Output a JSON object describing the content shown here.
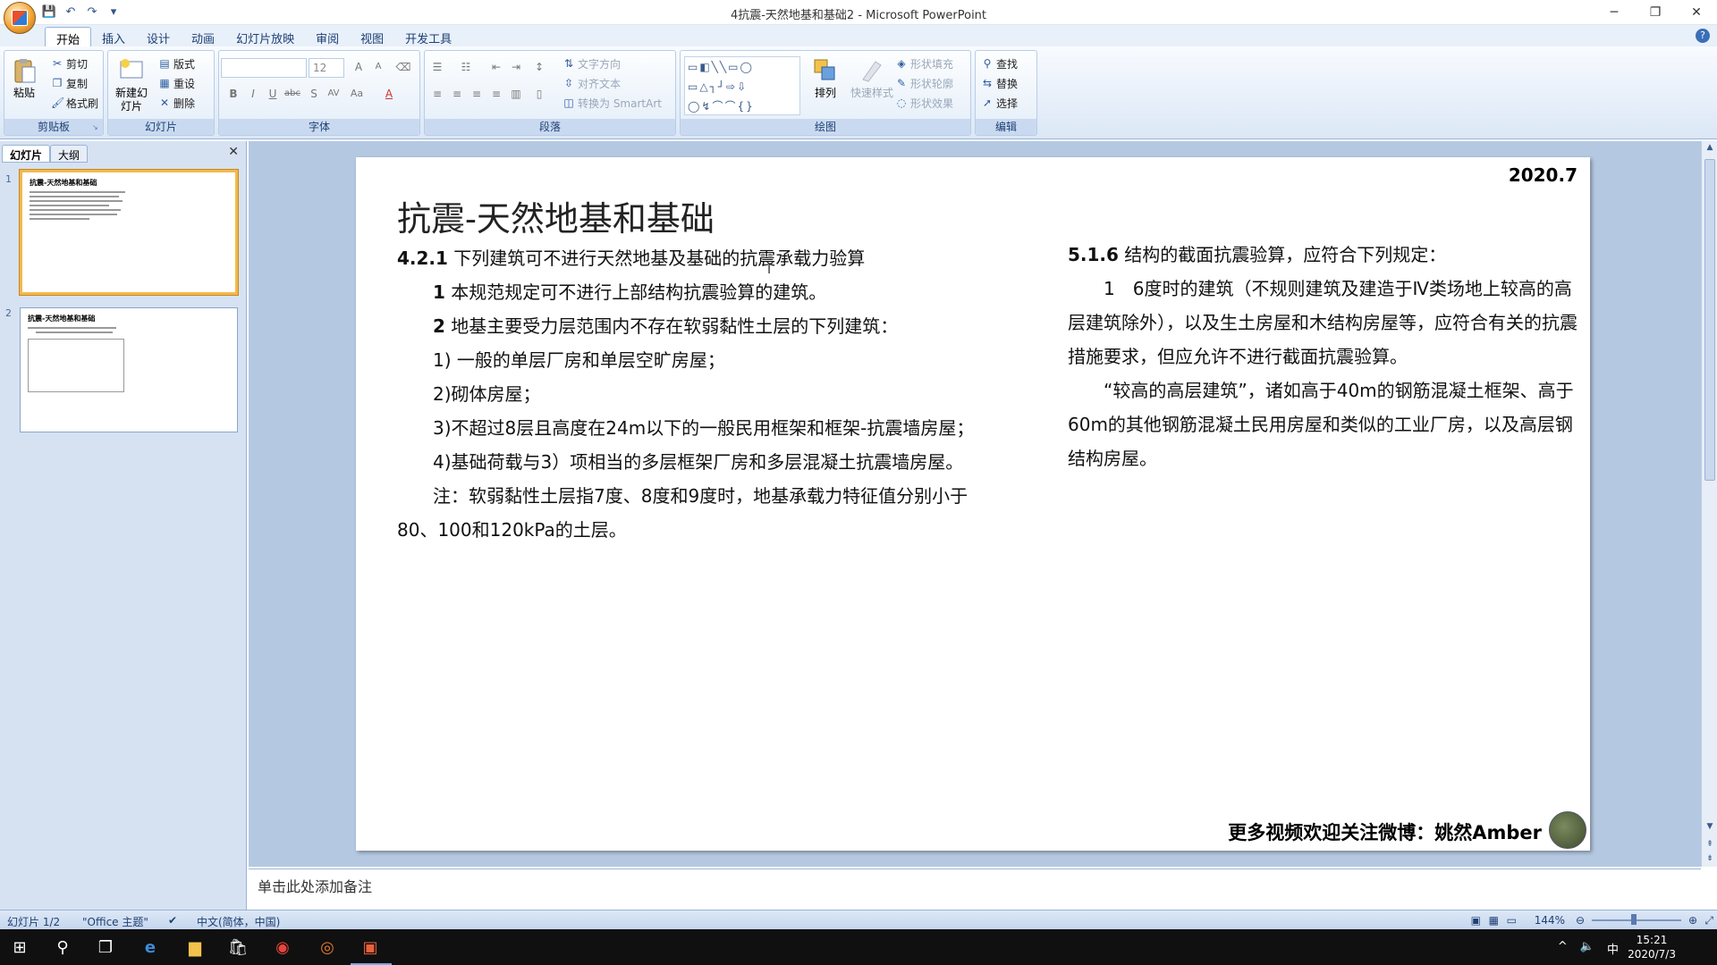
{
  "window": {
    "title": "4抗震-天然地基和基础2 - Microsoft PowerPoint"
  },
  "qat": {
    "save": "💾",
    "undo": "↶",
    "redo": "↷",
    "more": "▾"
  },
  "window_controls": {
    "min": "─",
    "max": "❐",
    "close": "✕"
  },
  "ribbon_tabs": [
    "开始",
    "插入",
    "设计",
    "动画",
    "幻灯片放映",
    "审阅",
    "视图",
    "开发工具"
  ],
  "help": "?",
  "groups": {
    "clipboard": {
      "label": "剪贴板",
      "paste": "粘贴",
      "cut": "剪切",
      "copy": "复制",
      "format_painter": "格式刷"
    },
    "slides": {
      "label": "幻灯片",
      "new_slide": "新建幻灯片",
      "layout": "版式",
      "reset": "重设",
      "delete": "删除"
    },
    "font": {
      "label": "字体",
      "font_size": "12"
    },
    "paragraph": {
      "label": "段落",
      "text_direction": "文字方向",
      "align_text": "对齐文本",
      "smartart": "转换为 SmartArt"
    },
    "drawing": {
      "label": "绘图",
      "arrange": "排列",
      "quick_styles": "快速样式",
      "shape_fill": "形状填充",
      "shape_outline": "形状轮廓",
      "shape_effects": "形状效果"
    },
    "editing": {
      "label": "编辑",
      "find": "查找",
      "replace": "替换",
      "select": "选择"
    }
  },
  "panel": {
    "tab_slides": "幻灯片",
    "tab_outline": "大纲",
    "close": "✕"
  },
  "thumbs": [
    {
      "num": "1",
      "title": "抗震-天然地基和基础"
    },
    {
      "num": "2",
      "title": "抗震-天然地基和基础"
    }
  ],
  "slide": {
    "date": "2020.7",
    "title": "抗震-天然地基和基础",
    "left": {
      "h_num": "4.2.1",
      "h_text": " 下列建筑可不进行天然地基及基础的抗震承载力验算",
      "p1_num": "1",
      "p1_text": " 本规范规定可不进行上部结构抗震验算的建筑。",
      "p2_num": "2",
      "p2_text": " 地基主要受力层范围内不存在软弱黏性土层的下列建筑：",
      "i1": "1) 一般的单层厂房和单层空旷房屋；",
      "i2": "2)砌体房屋；",
      "i3": "3)不超过8层且高度在24m以下的一般民用框架和框架-抗震墙房屋；",
      "i4": "4)基础荷载与3）项相当的多层框架厂房和多层混凝土抗震墙房屋。",
      "note": "注：软弱黏性土层指7度、8度和9度时，地基承载力特征值分别小于80、100和120kPa的土层。"
    },
    "right": {
      "h_num": "5.1.6",
      "h_text": " 结构的截面抗震验算，应符合下列规定：",
      "p1": "1　6度时的建筑（不规则建筑及建造于Ⅳ类场地上较高的高层建筑除外），以及生土房屋和木结构房屋等，应符合有关的抗震措施要求，但应允许不进行截面抗震验算。",
      "p2": "“较高的高层建筑”，诸如高于40m的钢筋混凝土框架、高于60m的其他钢筋混凝土民用房屋和类似的工业厂房，以及高层钢结构房屋。"
    },
    "footer": "更多视频欢迎关注微博：姚然Amber"
  },
  "notes_placeholder": "单击此处添加备注",
  "status": {
    "slide_info": "幻灯片 1/2",
    "theme": "\"Office 主题\"",
    "language": "中文(简体，中国)",
    "zoom": "144%"
  },
  "taskbar": {
    "time": "15:21",
    "date": "2020/7/3",
    "ime": "中"
  }
}
